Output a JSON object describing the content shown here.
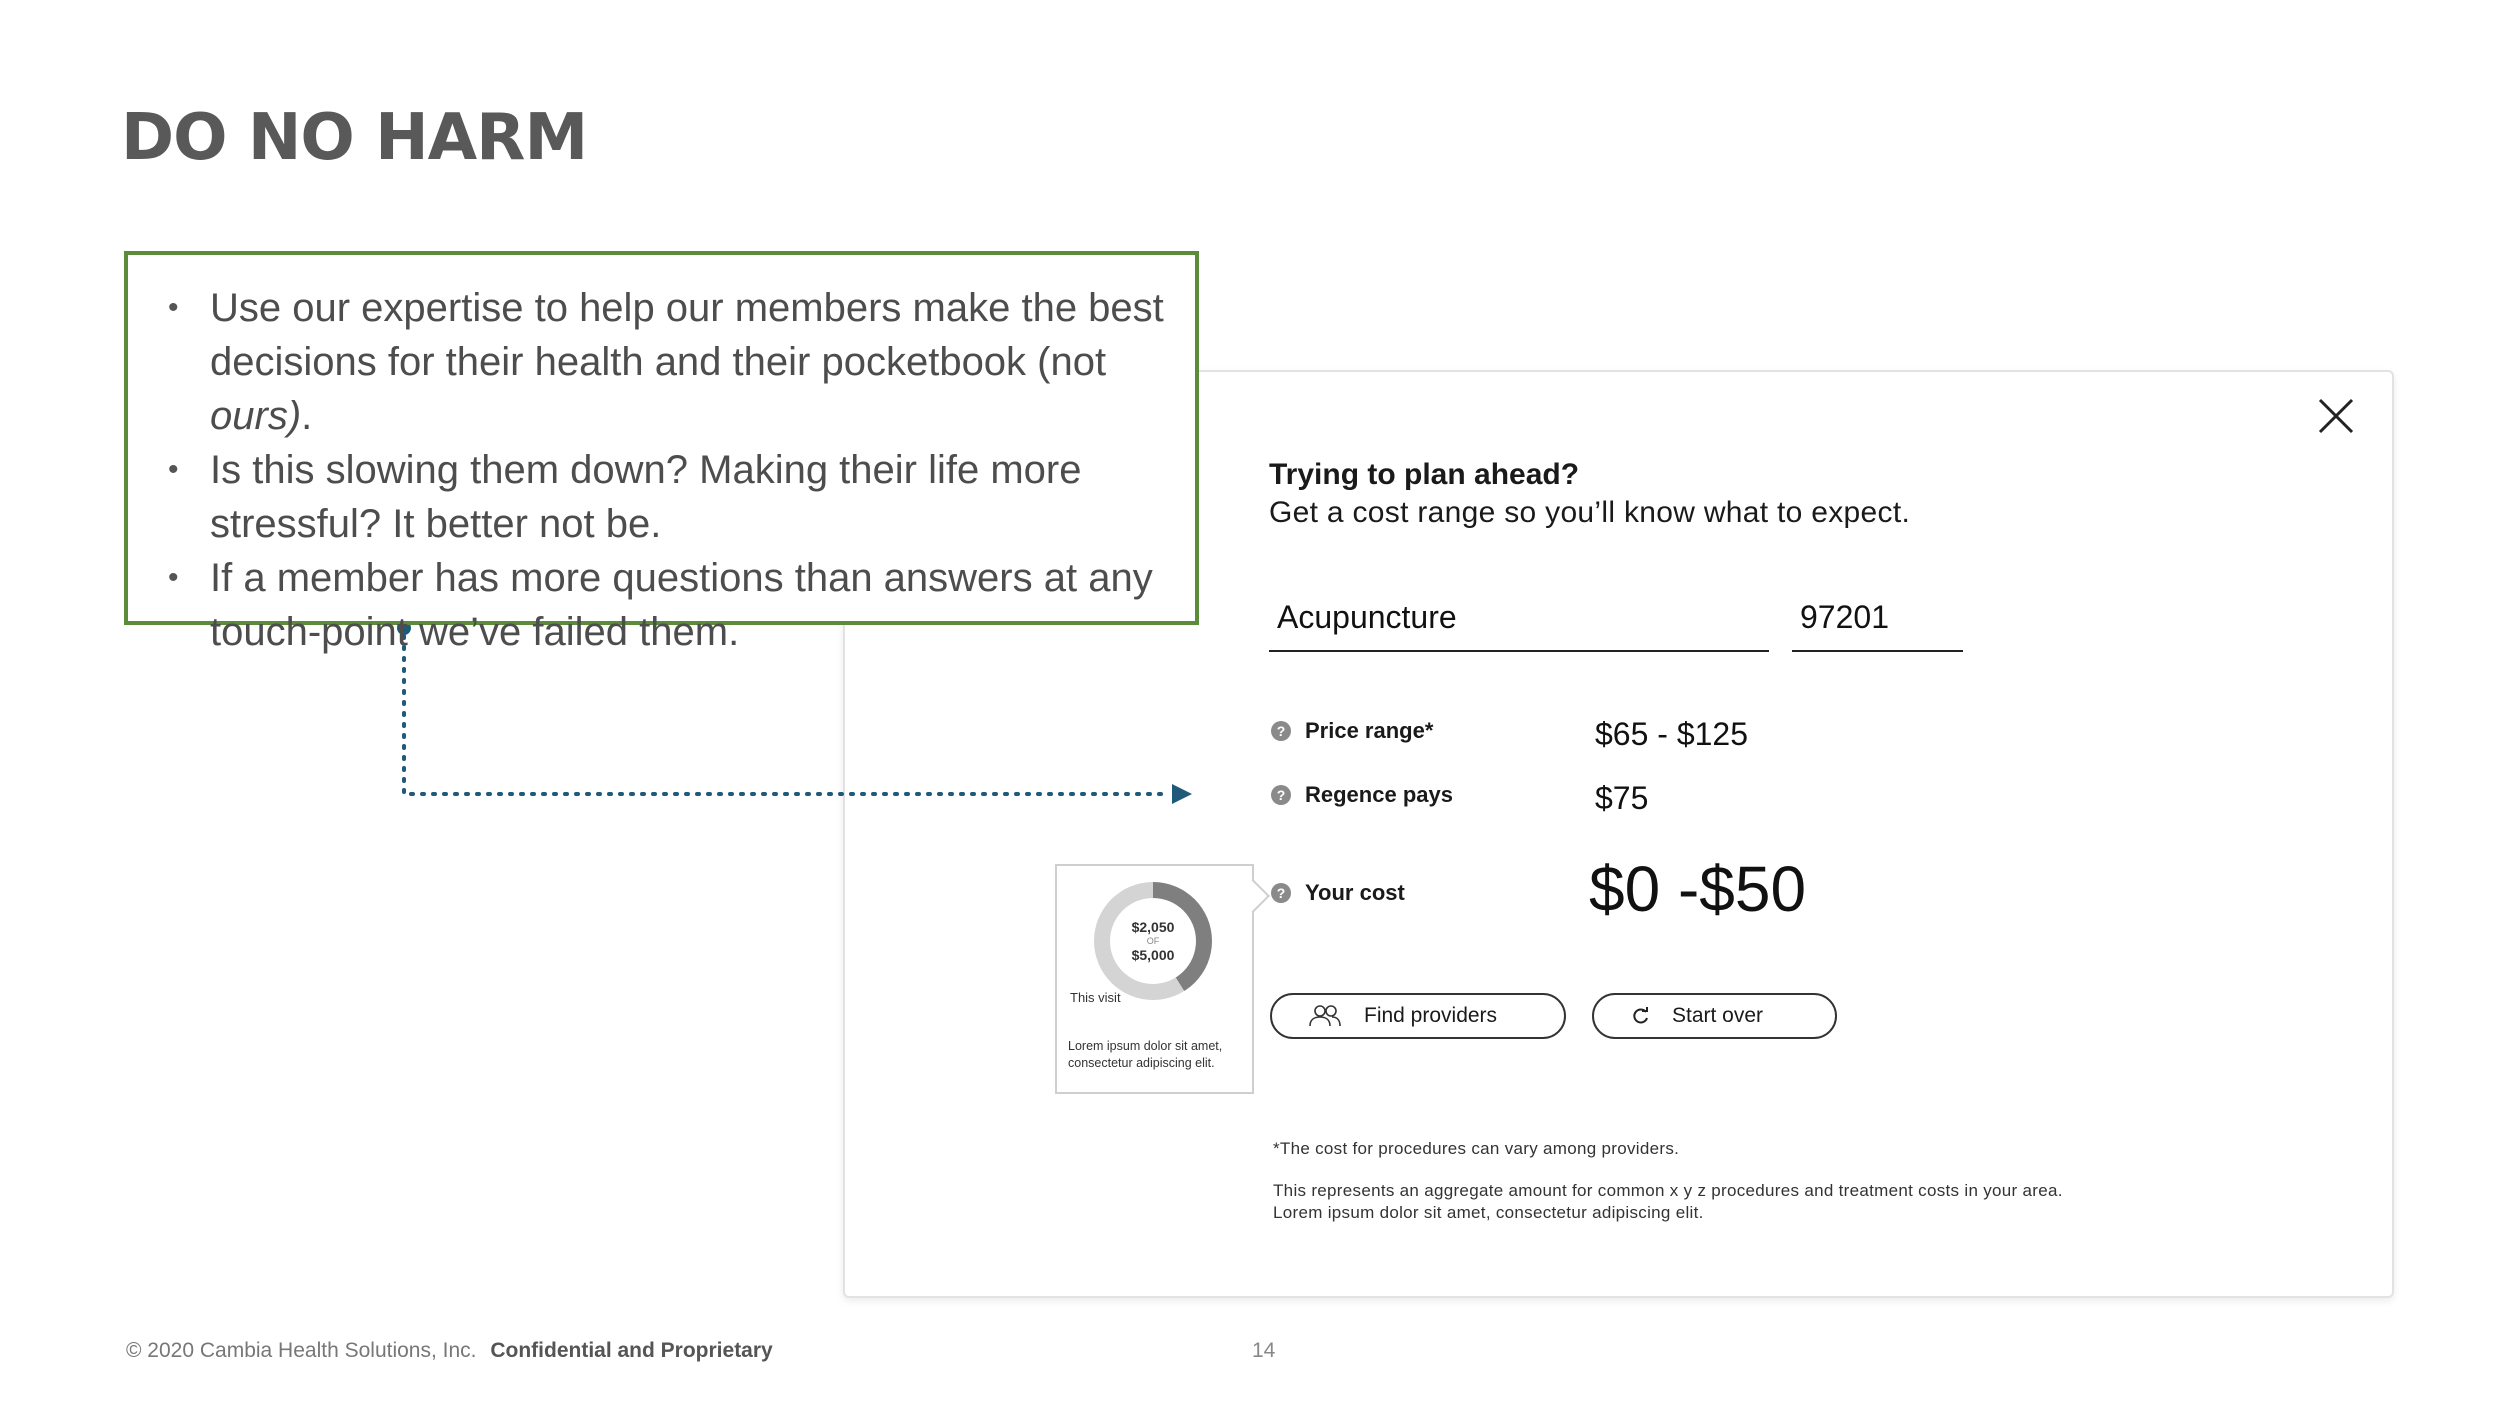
{
  "slide": {
    "title": "DO NO HARM",
    "bullets": [
      "Use our expertise to help our members make the best decisions for their health and their pocketbook (not ",
      "Is this slowing them down? Making their life more stressful? It better not be.",
      "If a member has more questions than answers at any touch-point we’ve failed them."
    ],
    "bullet1_emph": "ours)",
    "bullet1_tail": ".",
    "footer_copyright": "© 2020 Cambia Health Solutions, Inc.",
    "footer_confidential": "Confidential and Proprietary",
    "page_number": "14"
  },
  "modal": {
    "heading": "Trying to plan ahead?",
    "subheading": "Get a cost range so you’ll know what to expect.",
    "procedure_value": "Acupuncture",
    "zip_value": "97201",
    "price_range_label": "Price range*",
    "price_range_value": "$65 - $125",
    "regence_pays_label": "Regence pays",
    "regence_pays_value": "$75",
    "your_cost_label": "Your cost",
    "your_cost_value": "$0 -$50",
    "find_providers_label": "Find providers",
    "start_over_label": "Start over",
    "footnote1": "*The cost for procedures can vary among providers.",
    "footnote2": "This represents an aggregate amount for common x y z procedures and treatment costs in your area. Lorem ipsum dolor sit amet, consectetur adipiscing elit.",
    "help_glyph": "?"
  },
  "tooltip": {
    "spent": "$2,050",
    "of_label": "OF",
    "total": "$5,000",
    "spent_fraction": 0.41,
    "visit_label": "This visit",
    "text": "Lorem ipsum dolor sit amet, consectetur adipiscing elit."
  },
  "colors": {
    "callout_border": "#5b8c3a",
    "connector": "#1f5a7a",
    "title": "#595959"
  },
  "icons": [
    "close-icon",
    "help-icon",
    "people-icon",
    "refresh-icon"
  ]
}
